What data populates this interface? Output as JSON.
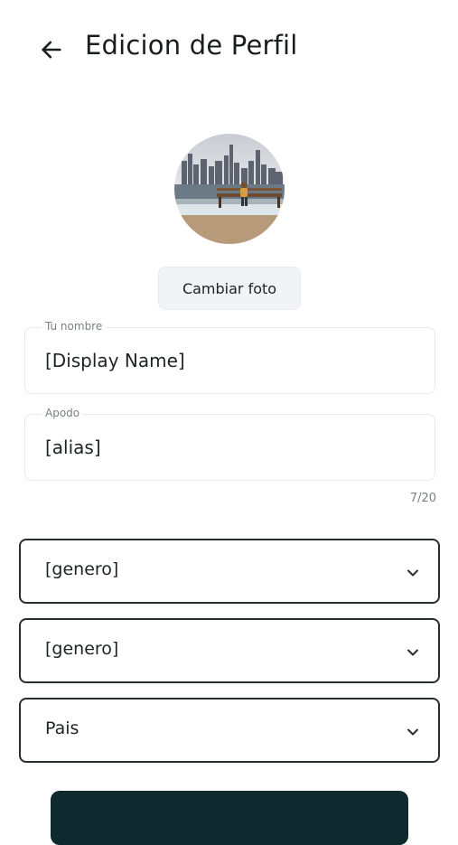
{
  "header": {
    "back_icon": "arrow-left-icon",
    "title": "Edicion de Perfil"
  },
  "profile": {
    "change_photo_label": "Cambiar foto"
  },
  "form": {
    "name_label": "Tu nombre",
    "name_value": "[Display Name]",
    "alias_label": "Apodo",
    "alias_value": "[alias]",
    "alias_counter": "7/20",
    "select_gender_1": "[genero]",
    "select_gender_2": "[genero]",
    "select_country": "Pais",
    "chevron_icon": "chevron-down-icon"
  },
  "colors": {
    "primary_button": "#0f2a2f",
    "border": "#2a2d30"
  }
}
